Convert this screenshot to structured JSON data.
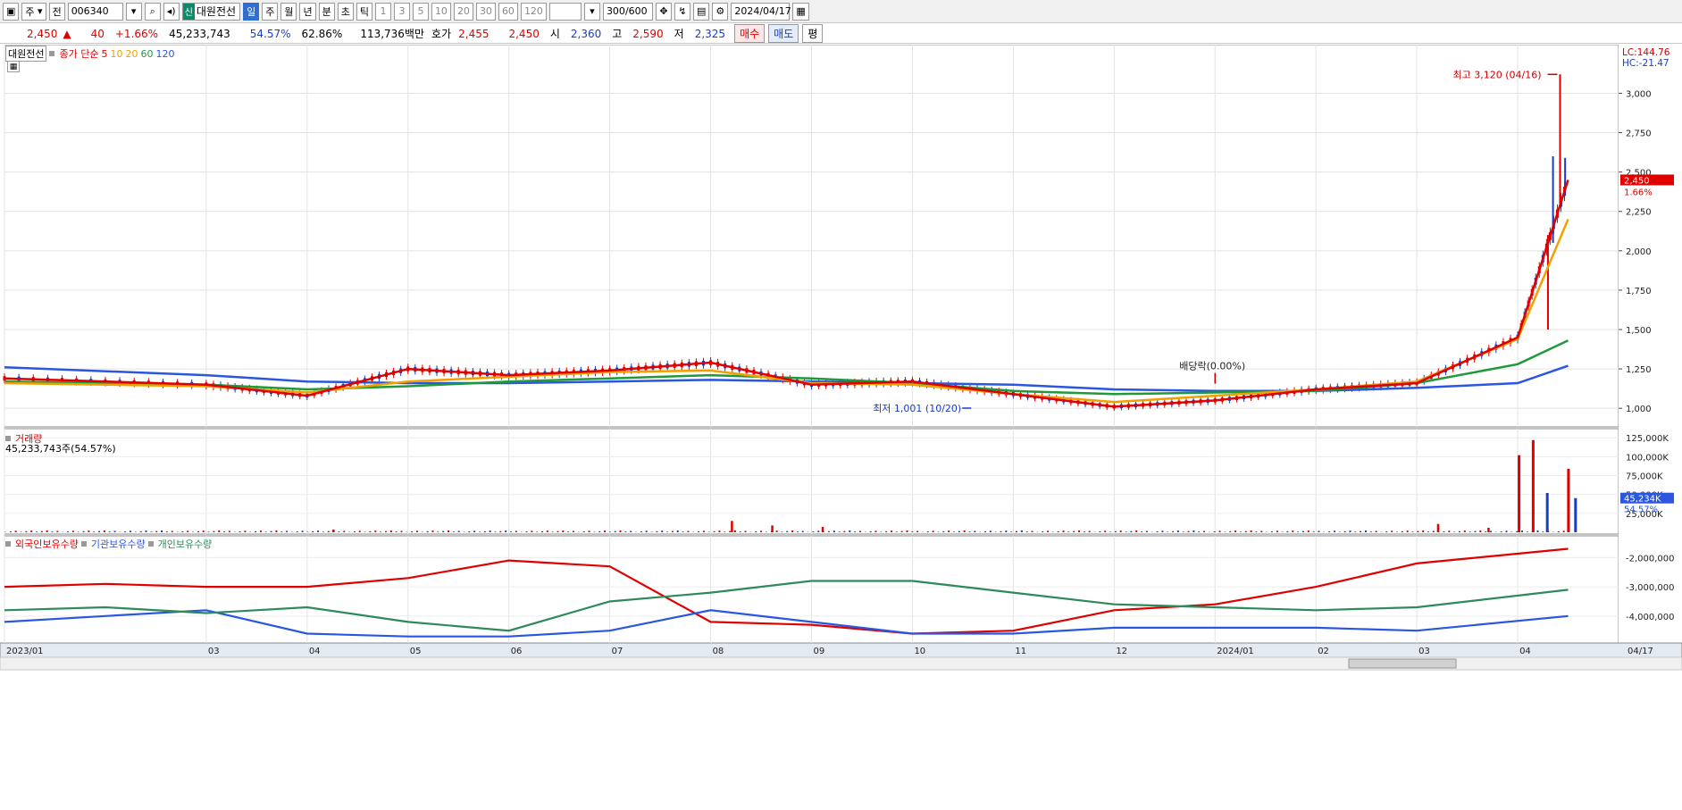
{
  "toolbar": {
    "period_label": "주",
    "period_type": "전",
    "code": "006340",
    "stock_badge": "신",
    "stock_name": "대원전선",
    "timeframes": [
      "일",
      "주",
      "월",
      "년",
      "분",
      "초",
      "틱"
    ],
    "intervals": [
      "1",
      "3",
      "5",
      "10",
      "20",
      "30",
      "60",
      "120"
    ],
    "count": "300",
    "count_total": "/600",
    "date": "2024/04/17"
  },
  "quote": {
    "price": "2,450",
    "arrow": "▲",
    "change": "40",
    "change_pct": "+1.66%",
    "volume": "45,233,743",
    "turnover_pct": "54.57%",
    "ratio": "62.86%",
    "amount": "113,736백만",
    "ask_label": "호가",
    "ask": "2,455",
    "bid": "2,450",
    "open_label": "시",
    "open": "2,360",
    "high_label": "고",
    "high": "2,590",
    "low_label": "저",
    "low": "2,325",
    "buy_label": "매수",
    "sell_label": "매도",
    "eval_label": "평"
  },
  "price_panel": {
    "stock_tag": "대원전선",
    "ma_title": "종가 단순",
    "ma_periods": [
      "5",
      "10",
      "20",
      "60",
      "120"
    ],
    "ma_colors": [
      "#e00000",
      "#f2a000",
      "#f2a000",
      "#1f9a3a",
      "#2a56e0"
    ],
    "lc": "LC:144.76",
    "hc": "HC:-21.47",
    "high_annotation": "최고 3,120 (04/16)",
    "low_annotation": "최저 1,001 (10/20)",
    "dividend_annotation": "배당락(0.00%)",
    "current_price_tag": "2,450",
    "current_pct_tag": "1.66%"
  },
  "volume_panel": {
    "title": "거래량",
    "value_text": "45,233,743주(54.57%)",
    "tag_value": "45,234K",
    "tag_pct": "54.57%"
  },
  "holdings_panel": {
    "series_names": [
      "외국인보유수량",
      "기관보유수량",
      "개인보유수량"
    ],
    "series_colors": [
      "#e00000",
      "#2a56e0",
      "#2e8a5a"
    ]
  },
  "x_axis": {
    "labels": [
      "2023/01",
      "03",
      "04",
      "05",
      "06",
      "07",
      "08",
      "09",
      "10",
      "11",
      "12",
      "2024/01",
      "02",
      "03",
      "04"
    ],
    "last_label": "04/17"
  },
  "chart_data": [
    {
      "type": "candlestick",
      "title": "대원전선",
      "ylim": [
        950,
        3150
      ],
      "y_ticks": [
        "3,000",
        "2,750",
        "2,500",
        "2,250",
        "2,000",
        "1,750",
        "1,500",
        "1,250",
        "1,000"
      ],
      "y_tick_values": [
        3000,
        2750,
        2500,
        2250,
        2000,
        1750,
        1500,
        1250,
        1000
      ],
      "x": [
        0,
        2,
        3,
        4,
        5,
        6,
        7,
        8,
        9,
        10,
        11,
        12,
        13,
        14,
        15,
        15.5
      ],
      "close": [
        1190,
        1150,
        1080,
        1250,
        1210,
        1240,
        1290,
        1150,
        1170,
        1090,
        1010,
        1050,
        1120,
        1160,
        1450,
        2450
      ],
      "ma20": [
        1160,
        1140,
        1100,
        1170,
        1200,
        1230,
        1240,
        1160,
        1150,
        1090,
        1040,
        1080,
        1120,
        1170,
        1440,
        2200
      ],
      "ma60": [
        1170,
        1150,
        1120,
        1140,
        1170,
        1190,
        1210,
        1190,
        1160,
        1110,
        1090,
        1100,
        1110,
        1160,
        1280,
        1430
      ],
      "ma120": [
        1260,
        1210,
        1170,
        1160,
        1160,
        1170,
        1180,
        1170,
        1160,
        1150,
        1120,
        1110,
        1110,
        1130,
        1160,
        1270
      ],
      "high_point": {
        "label": "최고 3,120 (04/16)",
        "value": 3120
      },
      "low_point": {
        "label": "최저 1,001 (10/20)",
        "value": 1001
      }
    },
    {
      "type": "bar",
      "title": "거래량",
      "ylim": [
        0,
        130000
      ],
      "y_ticks": [
        "125,000K",
        "100,000K",
        "75,000K",
        "50,000K",
        "25,000K"
      ],
      "y_tick_values": [
        125000,
        100000,
        75000,
        50000,
        25000
      ],
      "spikes": [
        {
          "x": 6.2,
          "value": 102000
        },
        {
          "x": 6.3,
          "value": 122000
        },
        {
          "x": 6.4,
          "value": 52000
        },
        {
          "x": 6.55,
          "value": 84000
        },
        {
          "x": 6.6,
          "value": 45234
        }
      ]
    },
    {
      "type": "line",
      "title": "보유수량",
      "ylim": [
        -4800000,
        -1500000
      ],
      "y_ticks": [
        "-2,000,000",
        "-3,000,000",
        "-4,000,000"
      ],
      "y_tick_values": [
        -2000000,
        -3000000,
        -4000000
      ],
      "series": [
        {
          "name": "외국인보유수량",
          "values": [
            -3000000,
            -2900000,
            -3000000,
            -3000000,
            -2700000,
            -2100000,
            -2300000,
            -4200000,
            -4300000,
            -4600000,
            -4500000,
            -3800000,
            -3600000,
            -3000000,
            -2200000,
            -1700000
          ]
        },
        {
          "name": "기관보유수량",
          "values": [
            -4200000,
            -4000000,
            -3800000,
            -4600000,
            -4700000,
            -4700000,
            -4500000,
            -3800000,
            -4200000,
            -4600000,
            -4600000,
            -4400000,
            -4400000,
            -4400000,
            -4500000,
            -4000000
          ]
        },
        {
          "name": "개인보유수량",
          "values": [
            -3800000,
            -3700000,
            -3900000,
            -3700000,
            -4200000,
            -4500000,
            -3500000,
            -3200000,
            -2800000,
            -2800000,
            -3200000,
            -3600000,
            -3700000,
            -3800000,
            -3700000,
            -3100000
          ]
        }
      ]
    }
  ]
}
